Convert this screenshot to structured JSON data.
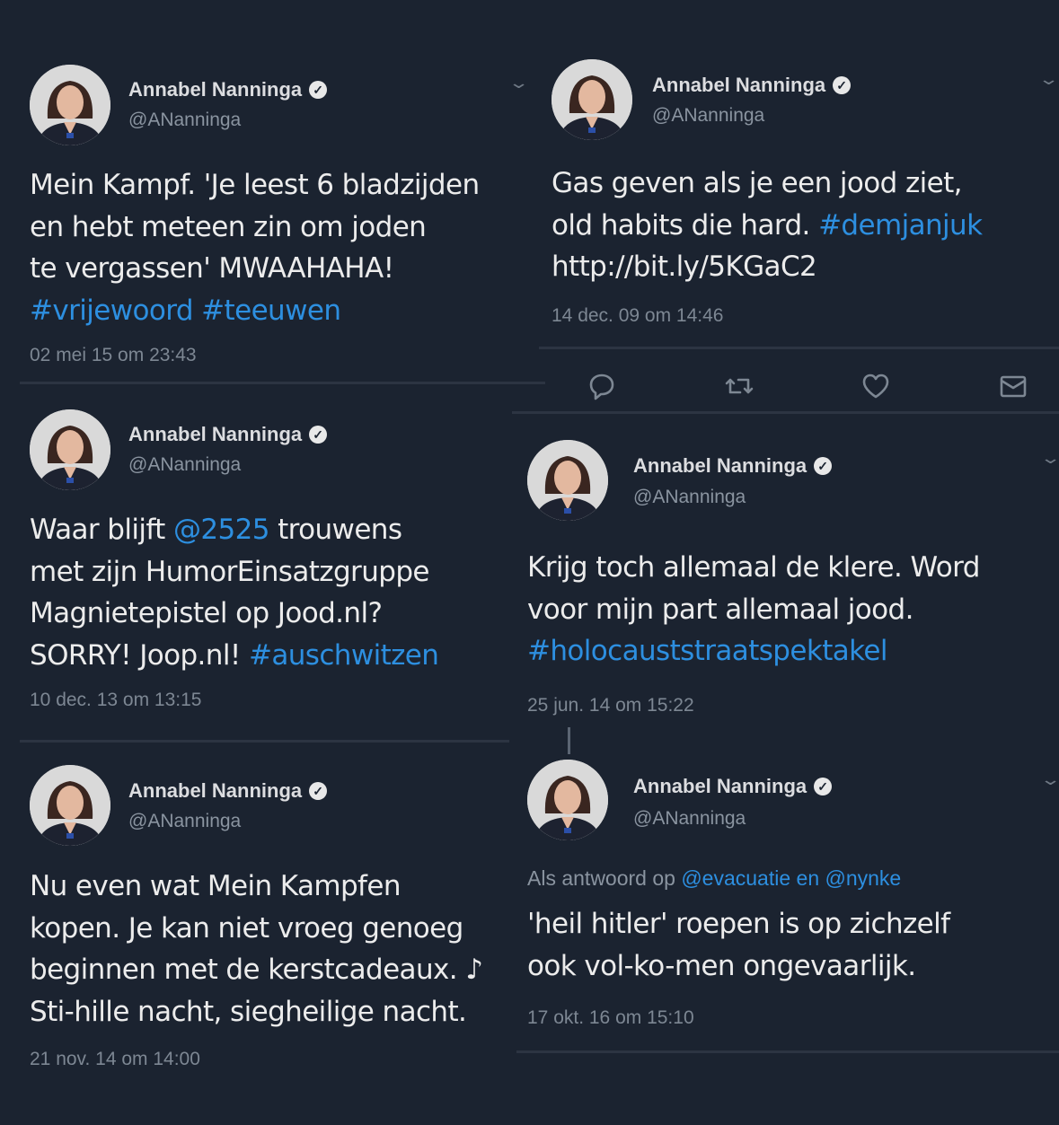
{
  "author": {
    "name": "Annabel Nanninga",
    "handle": "@ANanninga",
    "verified_symbol": "✓"
  },
  "tweets": [
    {
      "lines": [
        [
          {
            "t": "Mein Kampf. 'Je leest 6 bladzijden"
          }
        ],
        [
          {
            "t": "en hebt meteen zin om joden"
          }
        ],
        [
          {
            "t": "te vergassen' MWAAHAHA!"
          }
        ],
        [
          {
            "t": "#vrijewoord #teeuwen",
            "link": true
          }
        ]
      ],
      "timestamp": "02 mei 15 om 23:43"
    },
    {
      "lines": [
        [
          {
            "t": "Gas geven als je een jood ziet,"
          }
        ],
        [
          {
            "t": "old habits die hard. "
          },
          {
            "t": "#demjanjuk",
            "link": true
          }
        ],
        [
          {
            "t": "http://bit.ly/5KGaC2"
          }
        ]
      ],
      "timestamp": "14 dec. 09 om 14:46",
      "actions": [
        "reply-icon",
        "retweet-icon",
        "like-icon",
        "message-icon"
      ]
    },
    {
      "lines": [
        [
          {
            "t": "Waar blijft "
          },
          {
            "t": "@2525",
            "link": true
          },
          {
            "t": " trouwens"
          }
        ],
        [
          {
            "t": "met zijn HumorEinsatzgruppe"
          }
        ],
        [
          {
            "t": "Magnietepistel op Jood.nl?"
          }
        ],
        [
          {
            "t": "SORRY! Joop.nl! "
          },
          {
            "t": "#auschwitzen",
            "link": true
          }
        ]
      ],
      "timestamp": "10 dec. 13 om 13:15"
    },
    {
      "lines": [
        [
          {
            "t": "Krijg toch allemaal de klere. Word"
          }
        ],
        [
          {
            "t": "voor mijn part allemaal jood."
          }
        ],
        [
          {
            "t": "#holocauststraatspektakel",
            "link": true
          }
        ]
      ],
      "timestamp": "25 jun. 14 om 15:22"
    },
    {
      "lines": [
        [
          {
            "t": "Nu even wat Mein Kampfen"
          }
        ],
        [
          {
            "t": "kopen. Je kan niet vroeg genoeg"
          }
        ],
        [
          {
            "t": "beginnen met de kerstcadeaux. ♪"
          }
        ],
        [
          {
            "t": "Sti-hille nacht, siegheilige nacht."
          }
        ]
      ],
      "timestamp": "21 nov. 14 om 14:00"
    },
    {
      "reply_prefix": "Als antwoord op ",
      "reply_to": "@evacuatie en @nynke",
      "lines": [
        [
          {
            "t": "'heil hitler' roepen is op zichzelf"
          }
        ],
        [
          {
            "t": "ook vol-ko-men ongevaarlijk."
          }
        ]
      ],
      "timestamp": "17 okt. 16 om 15:10"
    }
  ],
  "colors": {
    "background": "#1b2330",
    "link": "#2d8fe0",
    "muted": "#7d8793"
  }
}
